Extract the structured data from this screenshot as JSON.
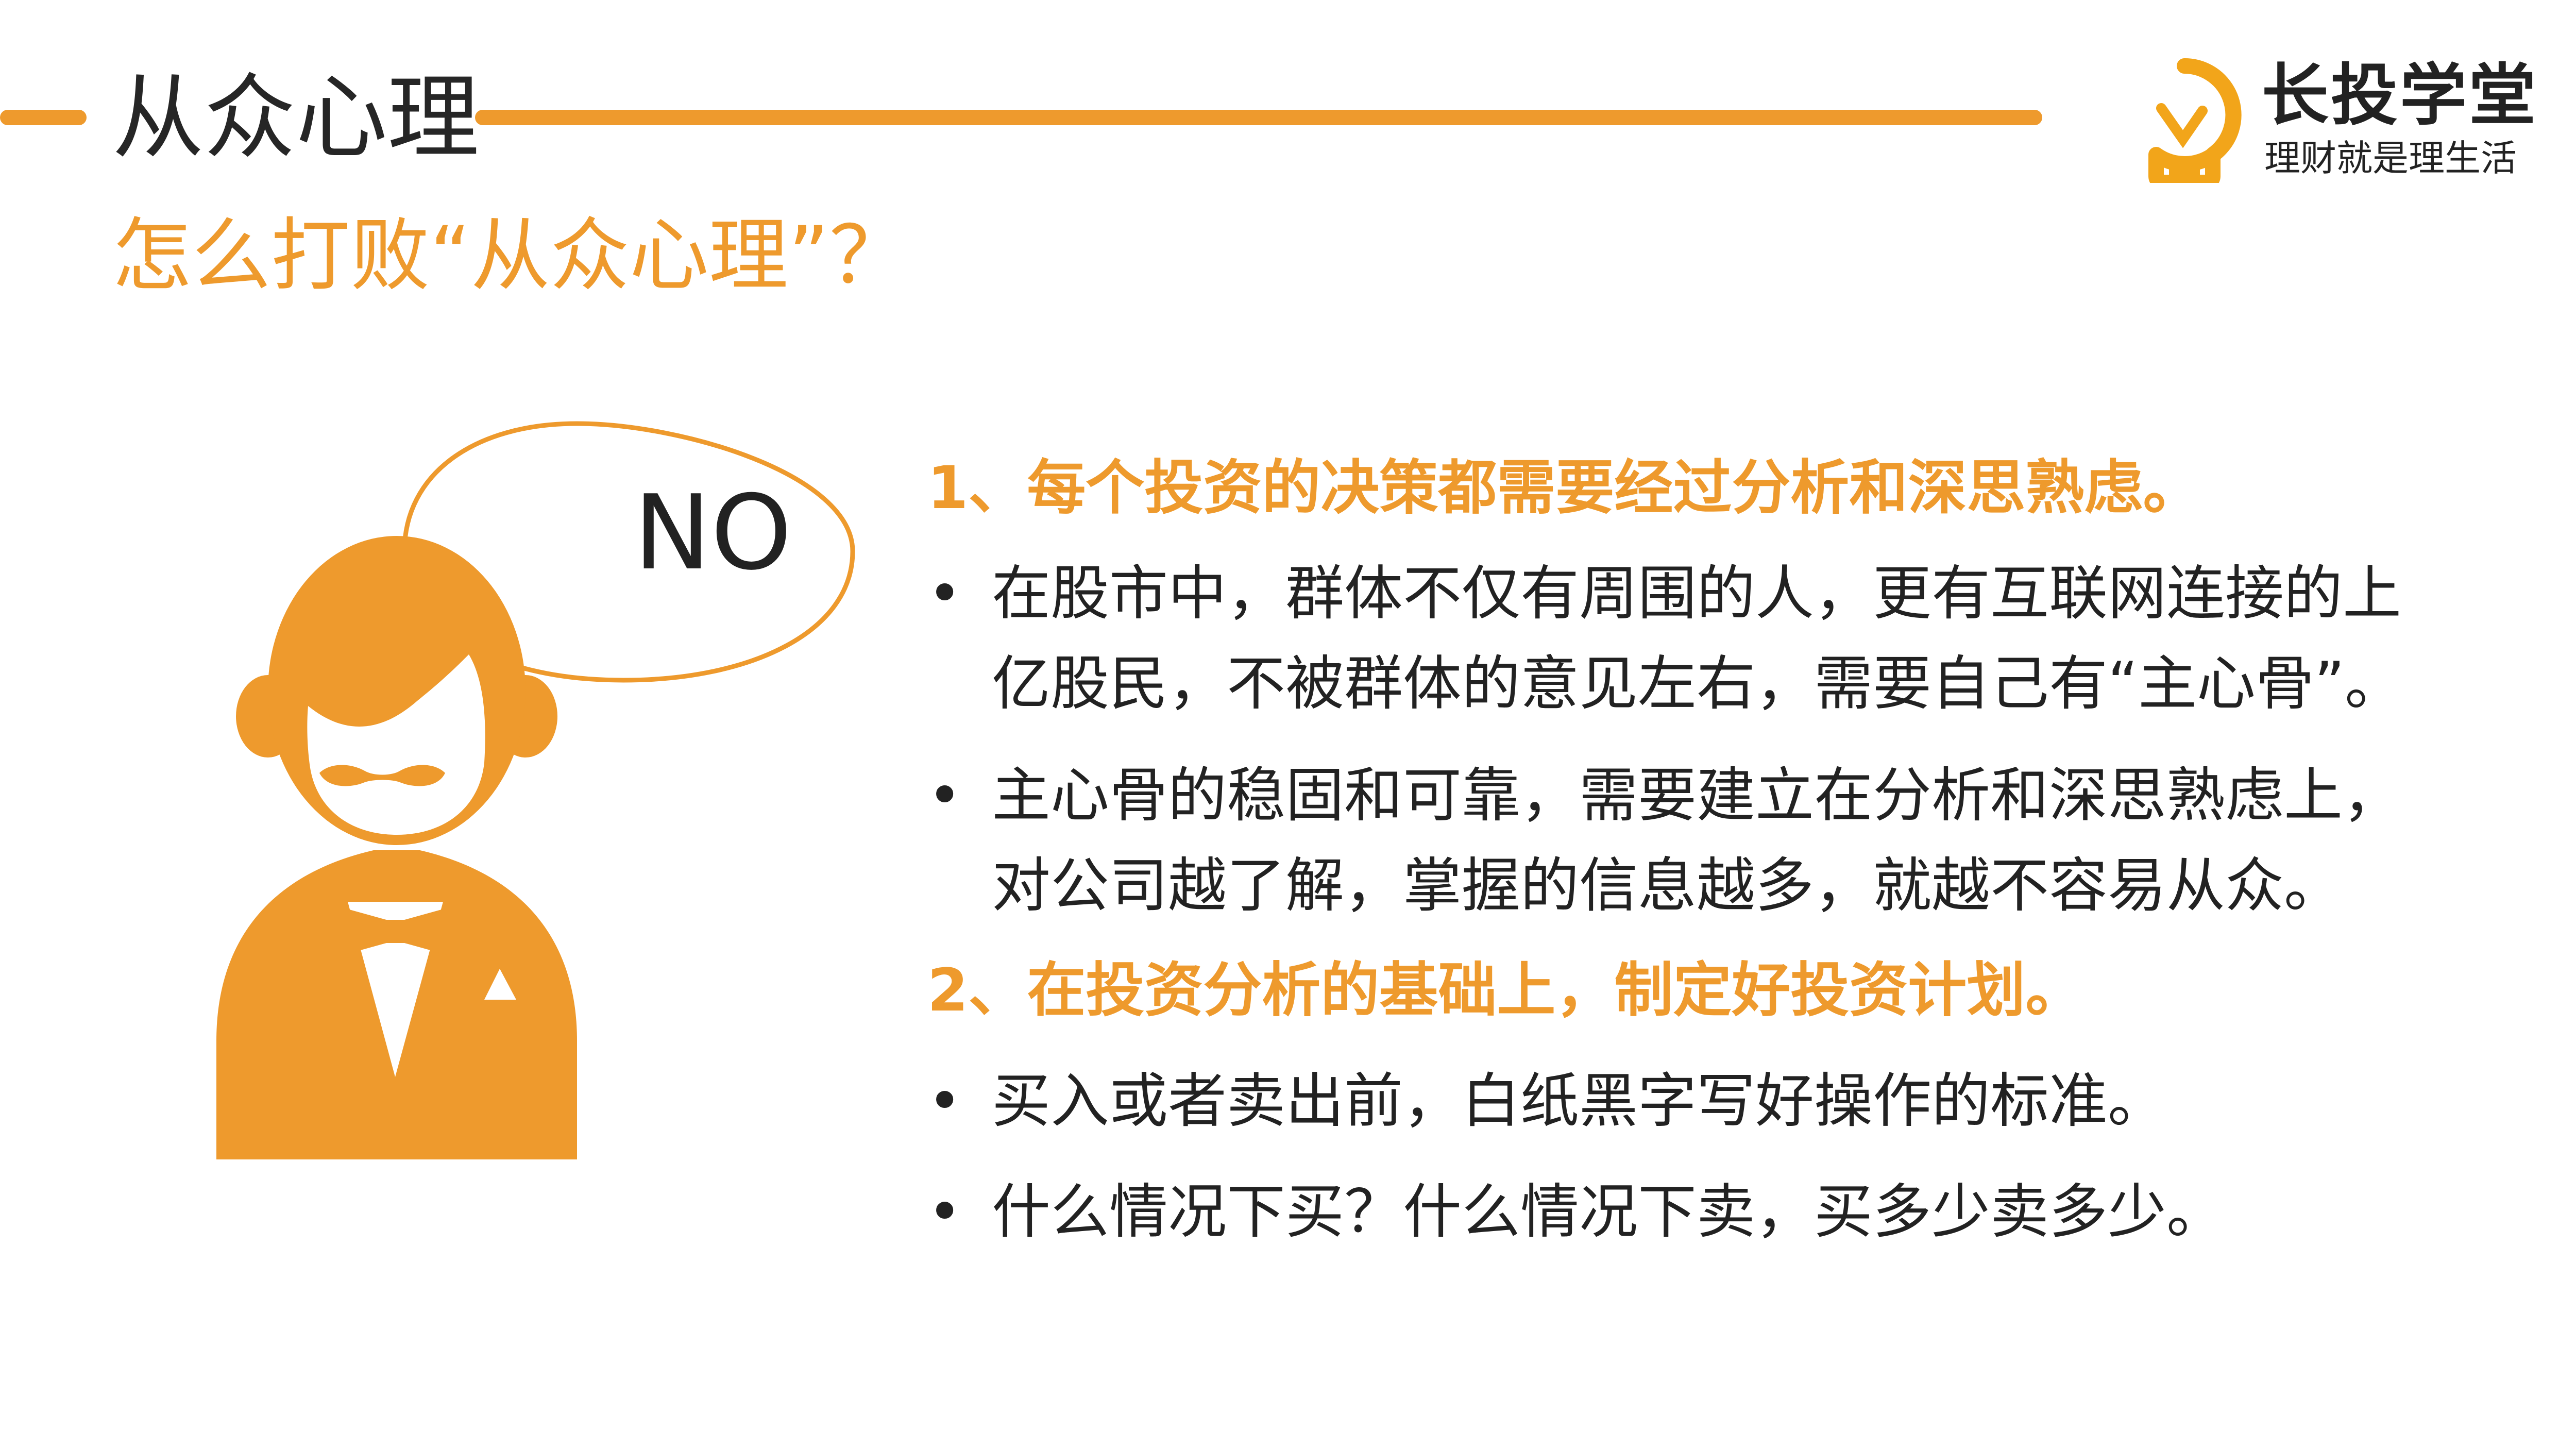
{
  "header": {
    "title": "从众心理",
    "subtitle": "怎么打败“从众心理”？",
    "accent_color": "#EE9A2D"
  },
  "logo": {
    "name": "长投学堂",
    "slogan": "理财就是理生活",
    "icon": "lightbulb-icon"
  },
  "illustration": {
    "speech_text": "NO",
    "icon": "businessman-icon"
  },
  "content": {
    "section1": {
      "heading": "1、每个投资的决策都需要经过分析和深思熟虑。",
      "bullets": [
        {
          "line1": "在股市中，群体不仅有周围的人，更有互联网连接的上",
          "line2": "亿股民，不被群体的意见左右，需要自己有“主心骨”。"
        },
        {
          "line1": "主心骨的稳固和可靠，需要建立在分析和深思熟虑上，",
          "line2": "对公司越了解，掌握的信息越多，就越不容易从众。"
        }
      ]
    },
    "section2": {
      "heading": "2、在投资分析的基础上，制定好投资计划。",
      "bullets": [
        {
          "line1": "买入或者卖出前，白纸黑字写好操作的标准。"
        },
        {
          "line1": "什么情况下买？什么情况下卖，买多少卖多少。"
        }
      ]
    },
    "bullet_symbol": "•"
  }
}
